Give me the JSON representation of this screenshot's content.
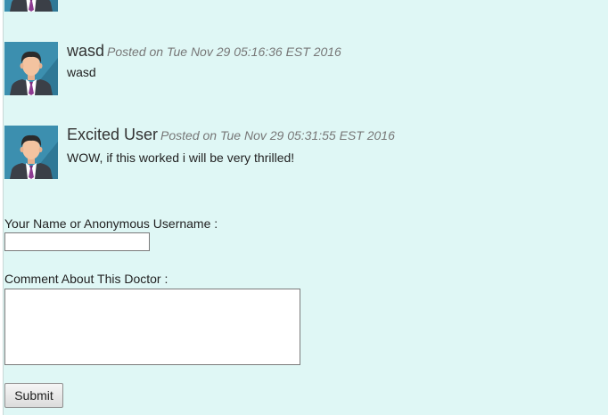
{
  "comments": [
    {
      "name": "",
      "posted": "",
      "text": ""
    },
    {
      "name": "wasd",
      "posted": "Posted on Tue Nov 29 05:16:36 EST 2016",
      "text": "wasd"
    },
    {
      "name": "Excited User",
      "posted": "Posted on Tue Nov 29 05:31:55 EST 2016",
      "text": "WOW, if this worked i will be very thrilled!"
    }
  ],
  "form": {
    "name_label": "Your Name or Anonymous Username :",
    "name_value": "",
    "comment_label": "Comment About This Doctor :",
    "comment_value": "",
    "submit_label": "Submit"
  },
  "colors": {
    "page_background": "#dff7f5",
    "avatar_background": "#3c8faf",
    "posted_text": "#777777"
  }
}
